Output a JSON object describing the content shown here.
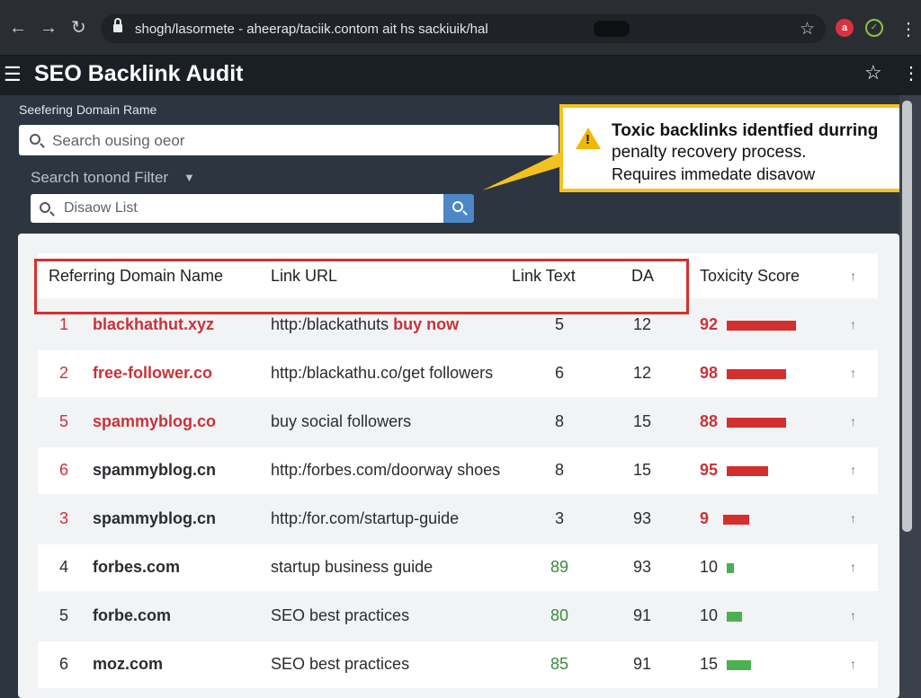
{
  "browser": {
    "url": "shogh/lasormete - aheerap/taciik.contom ait hs sackiuik/hal",
    "ext_red_label": "a",
    "ext_green_label": "✓"
  },
  "app": {
    "title": "SEO Backlink Audit"
  },
  "filters": {
    "section_label": "Seefering Domain Rame",
    "search_placeholder": "Search ousing oeor",
    "filter_label": "Search tonond Filter",
    "disavow_placeholder": "Disaow List"
  },
  "callout": {
    "line1": "Toxic backlinks identfied durring",
    "line2": "penalty recovery process.",
    "line3": "Requires immedate disavow"
  },
  "table": {
    "headers": {
      "domain": "Referring Domain Name",
      "url": "Link URL",
      "link_text": "Link Text",
      "da": "DA",
      "toxicity": "Toxicity Score"
    },
    "rows": [
      {
        "num": "1",
        "domain": "blackhathut.xyz",
        "url": "http:/blackathuts ",
        "url_hl": "buy now",
        "link_text": "5",
        "da": "12",
        "tox": "92",
        "tox_level": 0.92,
        "toxic": true
      },
      {
        "num": "2",
        "domain": "free-follower.co",
        "url": "http:/blackathu.co/get followers",
        "url_hl": "",
        "link_text": "6",
        "da": "12",
        "tox": "98",
        "tox_level": 0.78,
        "toxic": true
      },
      {
        "num": "5",
        "domain": "spammyblog.co",
        "url": "buy social followers",
        "url_hl": "",
        "link_text": "8",
        "da": "15",
        "tox": "88",
        "tox_level": 0.78,
        "toxic": true
      },
      {
        "num": "6",
        "domain": "spammyblog.cn",
        "url": "http:/forbes.com/doorway shoes",
        "url_hl": "",
        "link_text": "8",
        "da": "15",
        "tox": "95",
        "tox_level": 0.55,
        "toxic": true
      },
      {
        "num": "3",
        "domain": "spammyblog.cn",
        "url": "http:/for.com/startup-guide",
        "url_hl": "",
        "link_text": "3",
        "da": "93",
        "tox": "9",
        "tox_level": 0.35,
        "toxic": true
      },
      {
        "num": "4",
        "domain": "forbes.com",
        "url": "startup business guide",
        "url_hl": "",
        "link_text": "89",
        "da": "93",
        "tox": "10",
        "tox_level": 0.1,
        "toxic": false
      },
      {
        "num": "5",
        "domain": "forbe.com",
        "url": "SEO best practices",
        "url_hl": "",
        "link_text": "80",
        "da": "91",
        "tox": "10",
        "tox_level": 0.2,
        "toxic": false
      },
      {
        "num": "6",
        "domain": "moz.com",
        "url": "SEO best practices",
        "url_hl": "",
        "link_text": "85",
        "da": "91",
        "tox": "15",
        "tox_level": 0.32,
        "toxic": false
      }
    ]
  },
  "colors": {
    "toxic": "#c8333a",
    "toxic_bar": "#d32f2f",
    "safe": "#3a8a3d",
    "safe_bar": "#4caf50",
    "accent": "#4d87c7",
    "callout_border": "#f4c21f"
  }
}
